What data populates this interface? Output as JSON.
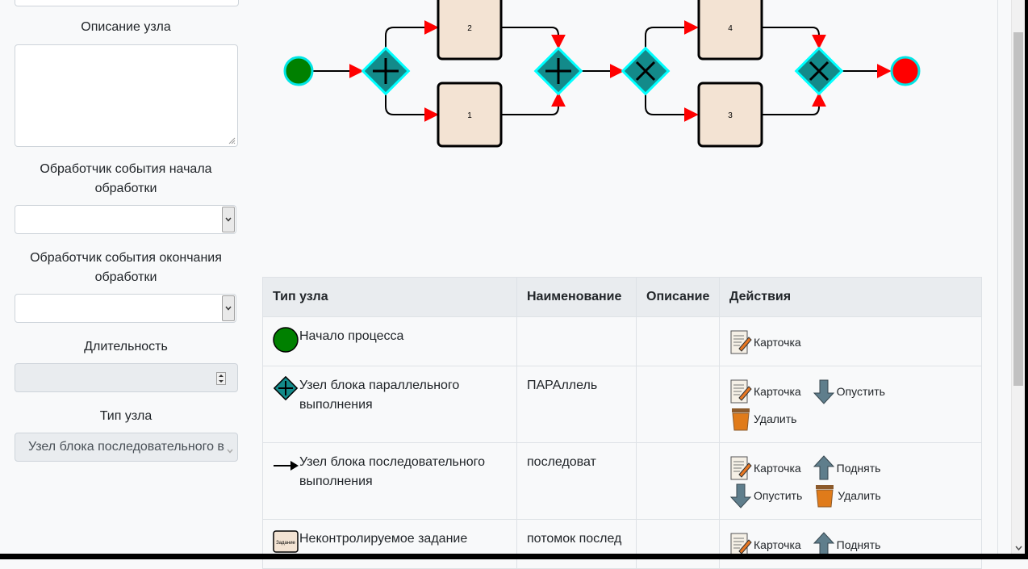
{
  "form": {
    "description_label": "Описание узла",
    "start_handler_label_1": "Обработчик события начала",
    "start_handler_label_2": "обработки",
    "end_handler_label_1": "Обработчик события окончания",
    "end_handler_label_2": "обработки",
    "duration_label": "Длительность",
    "node_type_label": "Тип узла",
    "node_type_value": "Узел блока последовательного выполнения"
  },
  "diagram": {
    "task_labels": [
      "2",
      "1",
      "4",
      "3"
    ],
    "colors": {
      "start": "#008000",
      "end": "#ff0000",
      "gateway": "#138a8a",
      "gateway_border": "#00ffff",
      "task": "#f3e3d3",
      "arrow": "#ff0000"
    }
  },
  "table": {
    "headers": [
      "Тип узла",
      "Наименование",
      "Описание",
      "Действия"
    ],
    "rows": [
      {
        "type": "Начало процесса",
        "name": "",
        "description": "",
        "actions": [
          "Карточка"
        ]
      },
      {
        "type": "Узел блока параллельного выполнения",
        "name": "ПАРАллель",
        "description": "",
        "actions": [
          "Карточка",
          "Опустить",
          "Удалить"
        ]
      },
      {
        "type": "Узел блока последовательного выполнения",
        "name": "последоват",
        "description": "",
        "actions": [
          "Карточка",
          "Поднять",
          "Опустить",
          "Удалить"
        ]
      },
      {
        "type": "Неконтролируемое задание",
        "name": "потомок послед",
        "description": "",
        "actions": [
          "Карточка",
          "Поднять"
        ],
        "icon_label": "Задание"
      }
    ]
  }
}
